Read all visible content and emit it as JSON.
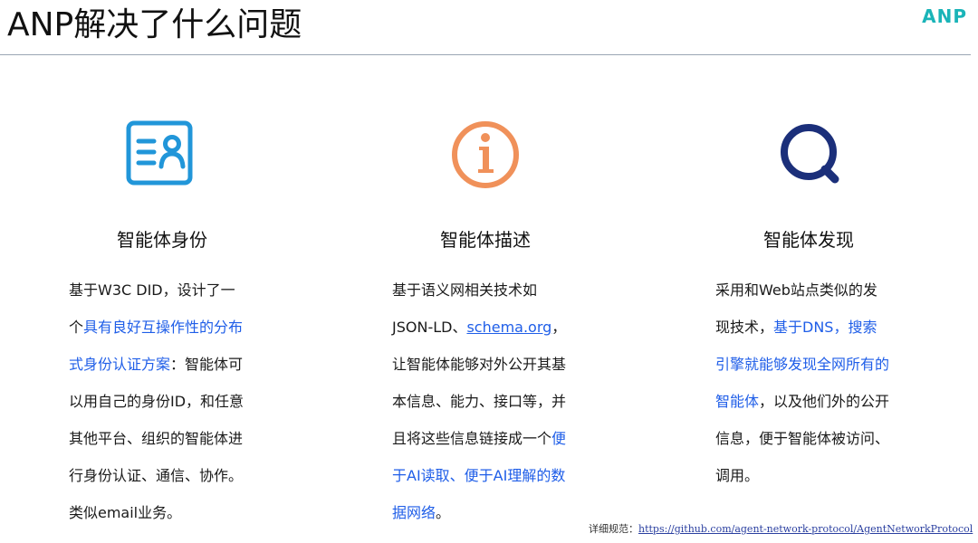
{
  "header": {
    "title": "ANP解决了什么问题",
    "logo_text": "ANP",
    "logo_color": "#1ab4b8"
  },
  "columns": [
    {
      "icon": "id-card-icon",
      "icon_color": "#2196d9",
      "heading": "智能体身份",
      "lines": [
        [
          {
            "t": "基于W3C DID，设计了一"
          }
        ],
        [
          {
            "t": "个"
          },
          {
            "t": "具有良好互操作性的分布",
            "hl": true
          }
        ],
        [
          {
            "t": "式身份认证方案",
            "hl": true
          },
          {
            "t": "：智能体可"
          }
        ],
        [
          {
            "t": "以用自己的身份ID，和任意"
          }
        ],
        [
          {
            "t": "其他平台、组织的智能体进"
          }
        ],
        [
          {
            "t": "行身份认证、通信、协作。"
          }
        ],
        [
          {
            "t": "类似email业务。"
          }
        ]
      ]
    },
    {
      "icon": "info-icon",
      "icon_color": "#f0915a",
      "heading": "智能体描述",
      "lines": [
        [
          {
            "t": "基于语义网相关技术如"
          }
        ],
        [
          {
            "t": "JSON-LD、"
          },
          {
            "t": "schema.org",
            "link": true
          },
          {
            "t": "，"
          }
        ],
        [
          {
            "t": "让智能体能够对外公开其基"
          }
        ],
        [
          {
            "t": "本信息、能力、接口等，并"
          }
        ],
        [
          {
            "t": "且将这些信息链接成一个"
          },
          {
            "t": "便",
            "hl": true
          }
        ],
        [
          {
            "t": "于AI读取、便于AI理解的数",
            "hl": true
          }
        ],
        [
          {
            "t": "据网络",
            "hl": true
          },
          {
            "t": "。"
          }
        ]
      ]
    },
    {
      "icon": "search-icon",
      "icon_color": "#1b2f7a",
      "heading": "智能体发现",
      "lines": [
        [
          {
            "t": "采用和Web站点类似的发"
          }
        ],
        [
          {
            "t": "现技术，"
          },
          {
            "t": "基于DNS，搜索",
            "hl": true
          }
        ],
        [
          {
            "t": "引擎就能够发现全网所有的",
            "hl": true
          }
        ],
        [
          {
            "t": "智能体",
            "hl": true
          },
          {
            "t": "，以及他们外的公开"
          }
        ],
        [
          {
            "t": "信息，便于智能体被访问、"
          }
        ],
        [
          {
            "t": "调用。"
          }
        ]
      ]
    }
  ],
  "footer": {
    "label": "详细规范：",
    "url": "https://github.com/agent-network-protocol/AgentNetworkProtocol"
  },
  "colors": {
    "highlight": "#1f5ee8",
    "text": "#1a1a1a"
  }
}
